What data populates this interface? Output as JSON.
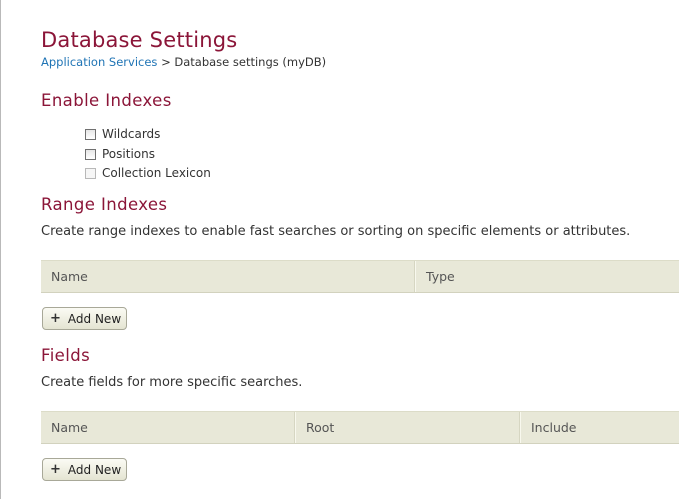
{
  "page": {
    "title": "Database Settings",
    "breadcrumb": {
      "link": "Application Services",
      "separator": ">",
      "current": "Database settings (myDB)"
    }
  },
  "enable_indexes": {
    "title": "Enable Indexes",
    "options": [
      {
        "label": "Wildcards",
        "checked": false,
        "enabled": true
      },
      {
        "label": "Positions",
        "checked": false,
        "enabled": true
      },
      {
        "label": "Collection Lexicon",
        "checked": false,
        "enabled": false
      }
    ]
  },
  "range_indexes": {
    "title": "Range Indexes",
    "description": "Create range indexes to enable fast searches or sorting on specific elements or attributes.",
    "columns": [
      "Name",
      "Type"
    ],
    "add_label": "Add New"
  },
  "fields": {
    "title": "Fields",
    "description": "Create fields for more specific searches.",
    "columns": [
      "Name",
      "Root",
      "Include"
    ],
    "add_label": "Add New"
  },
  "icons": {
    "add": "plus-icon"
  },
  "colors": {
    "heading": "#8b1538",
    "link": "#1f74b5",
    "table_header": "#e8e8d8"
  }
}
